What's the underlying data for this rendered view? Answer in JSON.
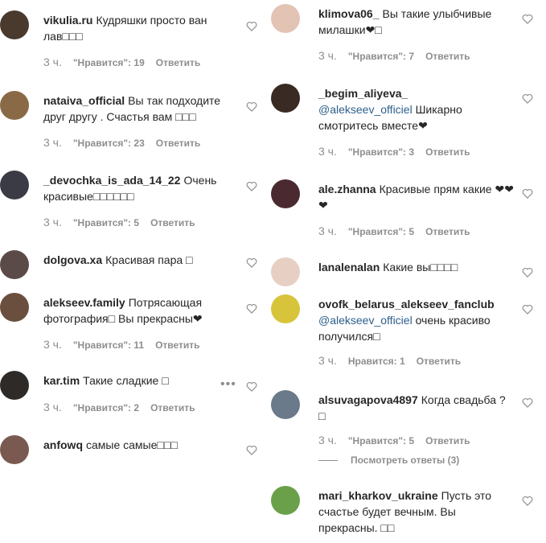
{
  "labels": {
    "likes_prefix": "\"Нравится\":",
    "likes_prefix_plain": "Нравится:",
    "reply": "Ответить"
  },
  "left_comments": [
    {
      "username": "vikulia.ru",
      "text": "Кудряшки просто ван лав□□□",
      "time": "3 ч.",
      "likes": "19",
      "avatar_color": "#4a3a2e"
    },
    {
      "username": "nataiva_official",
      "text": "Вы так подходите друг другу . Счастья вам □□□",
      "time": "3 ч.",
      "likes": "23",
      "avatar_color": "#8a6a46"
    },
    {
      "username": "_devochka_is_ada_14_22",
      "text": "Очень красивые□□□□□□",
      "time": "3 ч.",
      "likes": "5",
      "avatar_color": "#3b3b46"
    },
    {
      "username": "dolgova.xa",
      "text": "Красивая пара □",
      "avatar_color": "#5b4b48"
    },
    {
      "username": "alekseev.family",
      "text": "Потрясающая фотография□ Вы прекрасны❤",
      "time": "3 ч.",
      "likes": "11",
      "avatar_color": "#6a4e3e"
    },
    {
      "username": "kar.tim",
      "text": "Такие сладкие □",
      "time": "3 ч.",
      "likes": "2",
      "avatar_color": "#2e2a28"
    },
    {
      "username": "anfowq",
      "text": "самые самые□□□",
      "avatar_color": "#7a5a50"
    }
  ],
  "right_comments": [
    {
      "username": "klimova06_",
      "text": "Вы такие улыбчивые милашки❤□",
      "time": "3 ч.",
      "likes": "7",
      "avatar_color": "#e3c3b4"
    },
    {
      "username": "_begim_aliyeva_",
      "mention": "@alekseev_officiel",
      "text": "Шикарно смотритесь вместе❤",
      "time": "3 ч.",
      "likes": "3",
      "avatar_color": "#3a2a24"
    },
    {
      "username": "ale.zhanna",
      "text": "Красивые прям какие ❤❤❤",
      "time": "3 ч.",
      "likes": "5",
      "avatar_color": "#4a2a30"
    },
    {
      "username": "lanalenalan",
      "text": "Какие вы□□□□",
      "avatar_color": "#e8cfc4"
    },
    {
      "username": "ovofk_belarus_alekseev_fanclub",
      "mention": "@alekseev_officiel",
      "text": "очень красиво получился□",
      "time": "3 ч.",
      "likes": "1",
      "avatar_color": "#d8c43a"
    },
    {
      "username": "alsuvagapova4897",
      "text": "Когда свадьба ? □",
      "time": "3 ч.",
      "likes": "5",
      "view_replies": "Посмотреть ответы (3)",
      "avatar_color": "#6a7a8a"
    },
    {
      "username": "mari_kharkov_ukraine",
      "text": "Пусть это счастье будет вечным. Вы прекрасны. □□",
      "avatar_color": "#6aa04a"
    }
  ]
}
